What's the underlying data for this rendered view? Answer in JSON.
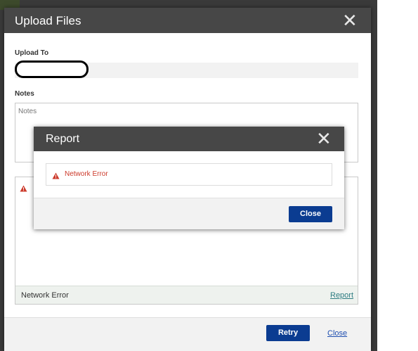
{
  "upload_dialog": {
    "title": "Upload Files",
    "close_icon": "close-icon",
    "upload_to_label": "Upload To",
    "upload_to_value": "",
    "notes_label": "Notes",
    "notes_placeholder": "Notes",
    "file_panel": {
      "warning_icon": "warning-icon",
      "status_text": "Network Error",
      "report_link": "Report"
    },
    "footer": {
      "retry_label": "Retry",
      "close_label": "Close"
    }
  },
  "report_dialog": {
    "title": "Report",
    "close_icon": "close-icon",
    "error_icon": "warning-icon",
    "error_message": "Network Error",
    "close_button_label": "Close"
  },
  "colors": {
    "header_bg": "#474747",
    "primary_button": "#0b3c91",
    "error_red": "#cc3a2b",
    "link_teal": "#2e7d82"
  }
}
